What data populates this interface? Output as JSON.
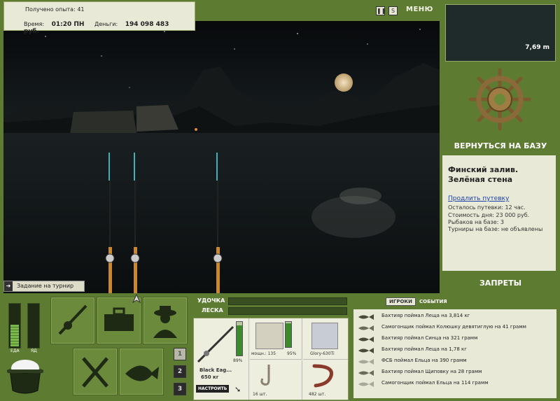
{
  "hud": {
    "exp_label": "Получено опыта: 41",
    "time_label": "Время:",
    "time_value": "01:20 ПН",
    "money_label": "Деньги:",
    "money_value": "194 098 483 руб."
  },
  "top_menu": {
    "menu_label": "МЕНЮ",
    "sound_label": "S"
  },
  "map": {
    "depth": "7,69 m"
  },
  "base": {
    "return_label": "ВЕРНУТЬСЯ НА БАЗУ",
    "title": "Финский залив. Зелёная стена",
    "extend_link": "Продлить путевку",
    "voucher_left": "Осталось путевки: 12 час.",
    "day_cost": "Стоимость дня: 23 000 руб.",
    "fishers": "Рыбаков на базе: 3",
    "tournaments": "Турниры на базе: не объявлены",
    "bans_label": "ЗАПРЕТЫ"
  },
  "task_bar": {
    "label": "Задание на турнир"
  },
  "meters": {
    "food_label": "ЕДА",
    "poison_label": "ЯД",
    "food_level": 0.5,
    "poison_level": 0.0
  },
  "pages": [
    "1",
    "2",
    "3"
  ],
  "tackle": {
    "rod_label": "УДОЧКА",
    "line_label": "ЛЕСКА",
    "rod_name": "Black Eag...",
    "rod_weight": "650 кг",
    "rod_percent": "89%",
    "reel_power": "мощн.: 135",
    "reel_percent": "95%",
    "line_name": "Glory-630Ti",
    "hooks_count": "16 шт.",
    "bait_count": "482 шт.",
    "setup_button": "НАСТРОИТЬ"
  },
  "events": {
    "tab_players": "ИГРОКИ",
    "tab_events": "СОБЫТИЯ",
    "items": [
      "Бахтияр поймал Леща на 3,814 кг",
      "Самогонщик поймал Колюшку девятиглую на 41 грамм",
      "Бахтияр поймал Синца на 321 грамм",
      "Бахтияр поймал Леща на 1,78 кг",
      "ФСБ поймал Ельца на 390 грамм",
      "Бахтияр поймал Щиповку на 28 грамм",
      "Самогонщик поймал Ельца на 114 грамм"
    ]
  }
}
